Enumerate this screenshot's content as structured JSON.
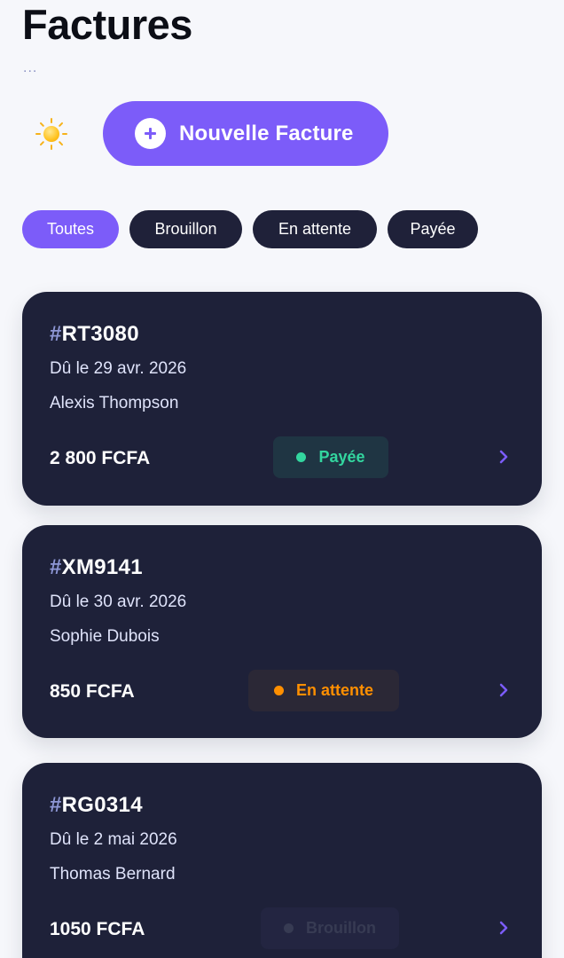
{
  "header": {
    "title": "Factures",
    "subtitle": "..."
  },
  "theme_toggle": {
    "icon": "sun-icon"
  },
  "new_invoice_button": {
    "label": "Nouvelle Facture",
    "icon": "plus-icon"
  },
  "filters": [
    {
      "label": "Toutes",
      "active": true
    },
    {
      "label": "Brouillon",
      "active": false
    },
    {
      "label": "En attente",
      "active": false
    },
    {
      "label": "Payée",
      "active": false
    }
  ],
  "invoices": [
    {
      "hash": "#",
      "id": "RT3080",
      "due": "Dû le 29 avr. 2026",
      "client": "Alexis Thompson",
      "amount": "2 800 FCFA",
      "status": "Payée",
      "status_key": "paid"
    },
    {
      "hash": "#",
      "id": "XM9141",
      "due": "Dû le 30 avr. 2026",
      "client": "Sophie Dubois",
      "amount": "850 FCFA",
      "status": "En attente",
      "status_key": "pending"
    },
    {
      "hash": "#",
      "id": "RG0314",
      "due": "Dû le 2 mai 2026",
      "client": "Thomas Bernard",
      "amount": "1050 FCFA",
      "status": "Brouillon",
      "status_key": "draft"
    }
  ],
  "colors": {
    "accent": "#7c5cf9",
    "card": "#1e2139",
    "paid": "#33d69f",
    "pending": "#ff8f00",
    "draft": "#373b53",
    "background": "#f6f7fb"
  }
}
